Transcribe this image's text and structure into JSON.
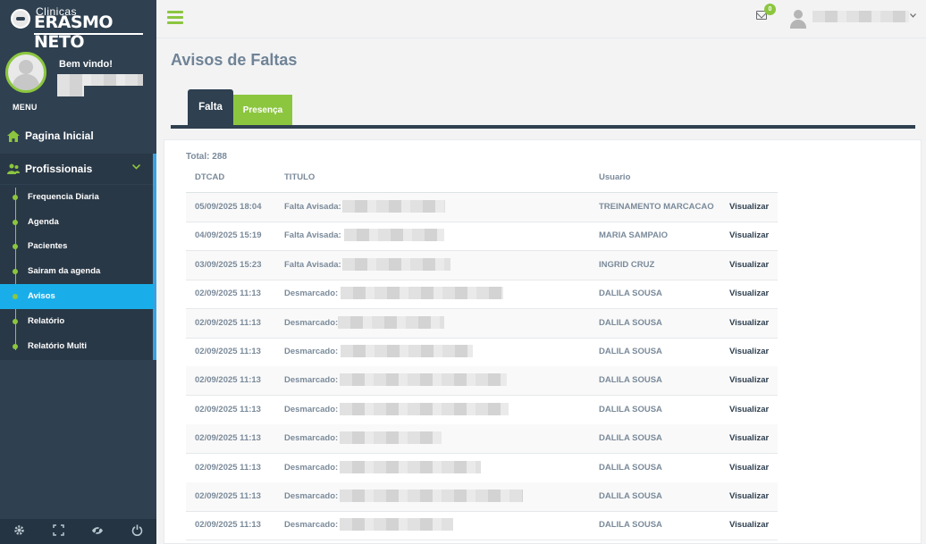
{
  "brand": {
    "small": "Clinicas",
    "big": "ERASMO NETO"
  },
  "sidebar": {
    "welcome": "Bem vindo!",
    "menu_label": "MENU",
    "home": "Pagina Inicial",
    "section": "Profissionais",
    "items": [
      {
        "label": "Frequencia Diaria",
        "active": false
      },
      {
        "label": "Agenda",
        "active": false
      },
      {
        "label": "Pacientes",
        "active": false
      },
      {
        "label": "Sairam da agenda",
        "active": false
      },
      {
        "label": "Avisos",
        "active": true
      },
      {
        "label": "Relatório",
        "active": false
      },
      {
        "label": "Relatório Multi",
        "active": false
      }
    ],
    "footer_icons": [
      "gear-icon",
      "expand-icon",
      "eye-slash-icon",
      "power-icon"
    ]
  },
  "topbar": {
    "notification_count": "0"
  },
  "page": {
    "title": "Avisos de Faltas",
    "tabs": [
      {
        "label": "Falta",
        "active": true
      },
      {
        "label": "Presença",
        "active": false
      }
    ],
    "total": "Total: 288",
    "columns": {
      "dtcad": "DTCAD",
      "titulo": "TITULO",
      "usuario": "Usuario"
    }
  },
  "rows": [
    {
      "dtcad": "05/09/2025 18:04",
      "titulo": "Falta Avisada:",
      "usuario": "TREINAMENTO MARCACAO",
      "action": "Visualizar"
    },
    {
      "dtcad": "04/09/2025 15:19",
      "titulo": "Falta Avisada:",
      "usuario": "MARIA SAMPAIO",
      "action": "Visualizar"
    },
    {
      "dtcad": "03/09/2025 15:23",
      "titulo": "Falta Avisada:",
      "usuario": "INGRID CRUZ",
      "action": "Visualizar"
    },
    {
      "dtcad": "02/09/2025 11:13",
      "titulo": "Desmarcado:",
      "usuario": "DALILA SOUSA",
      "action": "Visualizar"
    },
    {
      "dtcad": "02/09/2025 11:13",
      "titulo": "Desmarcado:",
      "usuario": "DALILA SOUSA",
      "action": "Visualizar"
    },
    {
      "dtcad": "02/09/2025 11:13",
      "titulo": "Desmarcado:",
      "usuario": "DALILA SOUSA",
      "action": "Visualizar"
    },
    {
      "dtcad": "02/09/2025 11:13",
      "titulo": "Desmarcado:",
      "usuario": "DALILA SOUSA",
      "action": "Visualizar"
    },
    {
      "dtcad": "02/09/2025 11:13",
      "titulo": "Desmarcado:",
      "usuario": "DALILA SOUSA",
      "action": "Visualizar"
    },
    {
      "dtcad": "02/09/2025 11:13",
      "titulo": "Desmarcado:",
      "usuario": "DALILA SOUSA",
      "action": "Visualizar"
    },
    {
      "dtcad": "02/09/2025 11:13",
      "titulo": "Desmarcado:",
      "usuario": "DALILA SOUSA",
      "action": "Visualizar"
    },
    {
      "dtcad": "02/09/2025 11:13",
      "titulo": "Desmarcado:",
      "usuario": "DALILA SOUSA",
      "action": "Visualizar"
    },
    {
      "dtcad": "02/09/2025 11:13",
      "titulo": "Desmarcado:",
      "usuario": "DALILA SOUSA",
      "action": "Visualizar"
    }
  ]
}
